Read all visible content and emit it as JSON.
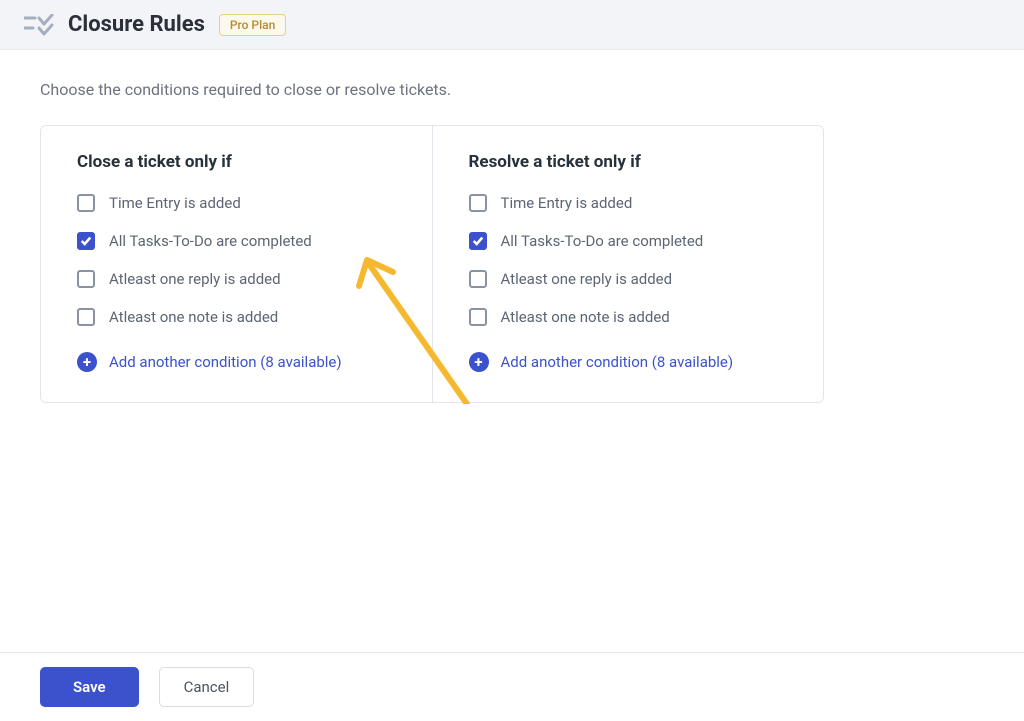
{
  "header": {
    "title": "Closure Rules",
    "plan_badge": "Pro Plan"
  },
  "description": "Choose the conditions required to close or resolve tickets.",
  "panels": {
    "close": {
      "title": "Close a ticket only if",
      "conditions": [
        {
          "label": "Time Entry is added",
          "checked": false
        },
        {
          "label": "All Tasks-To-Do are completed",
          "checked": true
        },
        {
          "label": "Atleast one reply is added",
          "checked": false
        },
        {
          "label": "Atleast one note is added",
          "checked": false
        }
      ],
      "add_label": "Add another condition (8 available)"
    },
    "resolve": {
      "title": "Resolve a ticket only if",
      "conditions": [
        {
          "label": "Time Entry is added",
          "checked": false
        },
        {
          "label": "All Tasks-To-Do are completed",
          "checked": true
        },
        {
          "label": "Atleast one reply is added",
          "checked": false
        },
        {
          "label": "Atleast one note is added",
          "checked": false
        }
      ],
      "add_label": "Add another condition (8 available)"
    }
  },
  "footer": {
    "save_label": "Save",
    "cancel_label": "Cancel"
  },
  "colors": {
    "accent": "#3b52cc",
    "badge_border": "#e9cf8a",
    "badge_text": "#b38a2e",
    "arrow": "#f5b82e"
  }
}
